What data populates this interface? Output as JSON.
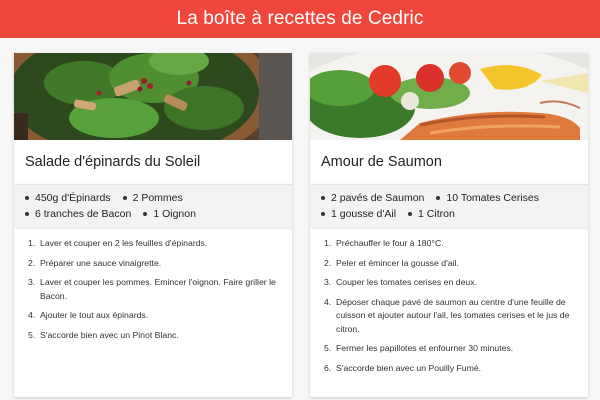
{
  "header": {
    "title": "La boîte à recettes de Cedric"
  },
  "colors": {
    "header_bg": "#f0473c",
    "card_bg": "#ffffff",
    "ingredients_bg": "#f3f3f3"
  },
  "recipes": [
    {
      "image": "salad-photo",
      "title": "Salade d'épinards du Soleil",
      "ingredients": [
        "450g d'Épinards",
        "2 Pommes",
        "6 tranches de Bacon",
        "1 Oignon"
      ],
      "steps": [
        "Laver et couper en 2 les feuilles d'épinards.",
        "Préparer une sauce vinaigrette.",
        "Laver et couper les pommes. Emincer l'oignon. Faire griller le Bacon.",
        "Ajouter le tout aux épinards.",
        "S'accorde bien avec un Pinot Blanc."
      ]
    },
    {
      "image": "salmon-photo",
      "title": "Amour de Saumon",
      "ingredients": [
        "2 pavés de Saumon",
        "10 Tomates Cerises",
        "1 gousse d'Ail",
        "1 Citron"
      ],
      "steps": [
        "Préchauffer le four à 180°C.",
        "Peler et émincer la gousse d'ail.",
        "Couper les tomates cerises en deux.",
        "Déposer chaque pavé de saumon au centre d'une feuille de cuisson et ajouter autour l'ail, les tomates cerises et le jus de citron.",
        "Fermer les papillotes et enfourner 30 minutes.",
        "S'accorde bien avec un Pouilly Fumé."
      ]
    }
  ]
}
